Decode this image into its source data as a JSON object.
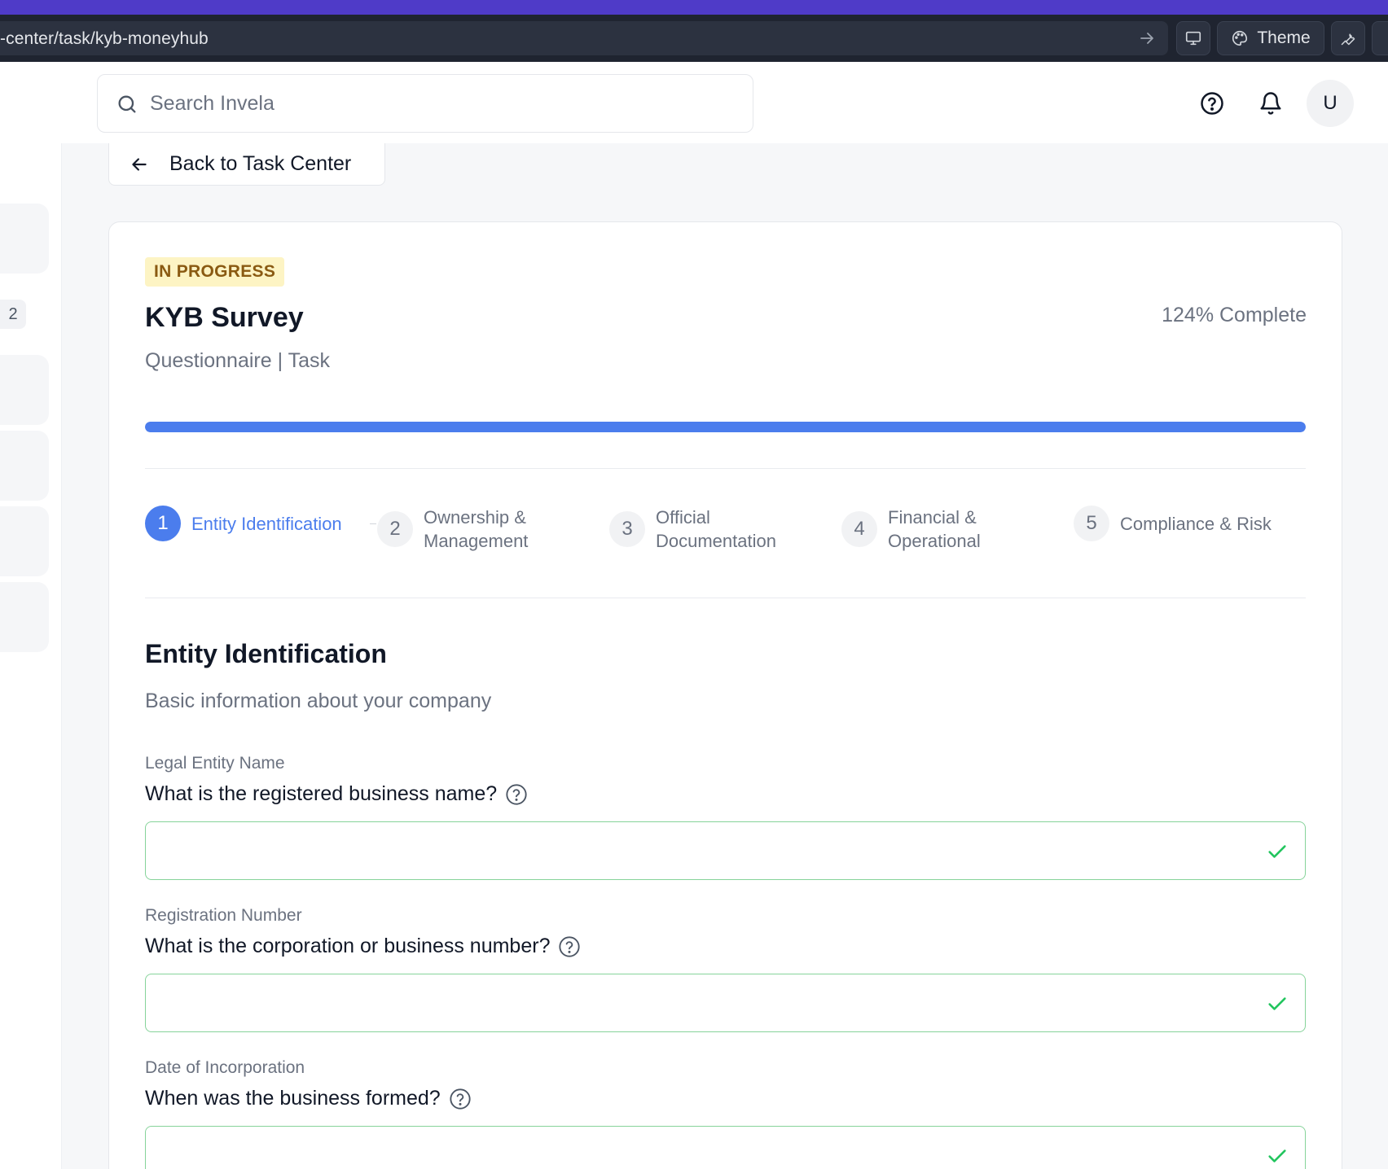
{
  "browser": {
    "url": "-center/task/kyb-moneyhub",
    "theme_label": "Theme"
  },
  "header": {
    "search_placeholder": "Search Invela",
    "avatar_initial": "U"
  },
  "sidebar": {
    "badge_count": "2"
  },
  "back_button": {
    "label": "Back to Task Center"
  },
  "task": {
    "status": "IN PROGRESS",
    "title": "KYB Survey",
    "subtitle": "Questionnaire | Task",
    "progress_text": "124% Complete",
    "progress_value": 1.0
  },
  "steps": [
    {
      "number": "1",
      "label": "Entity Identification",
      "active": true
    },
    {
      "number": "2",
      "label": "Ownership & Management",
      "active": false
    },
    {
      "number": "3",
      "label": "Official Documentation",
      "active": false
    },
    {
      "number": "4",
      "label": "Financial & Operational",
      "active": false
    },
    {
      "number": "5",
      "label": "Compliance & Risk",
      "active": false
    }
  ],
  "section": {
    "title": "Entity Identification",
    "description": "Basic information about your company"
  },
  "fields": [
    {
      "label": "Legal Entity Name",
      "question": "What is the registered business name?",
      "value": ""
    },
    {
      "label": "Registration Number",
      "question": "What is the corporation or business number?",
      "value": ""
    },
    {
      "label": "Date of Incorporation",
      "question": "When was the business formed?",
      "value": ""
    }
  ],
  "colors": {
    "accent": "#4b7ded",
    "success": "#22c55e",
    "status_bg": "#fdf4c4",
    "status_text": "#8a5a12",
    "browser_strip": "#4f3bc8"
  }
}
